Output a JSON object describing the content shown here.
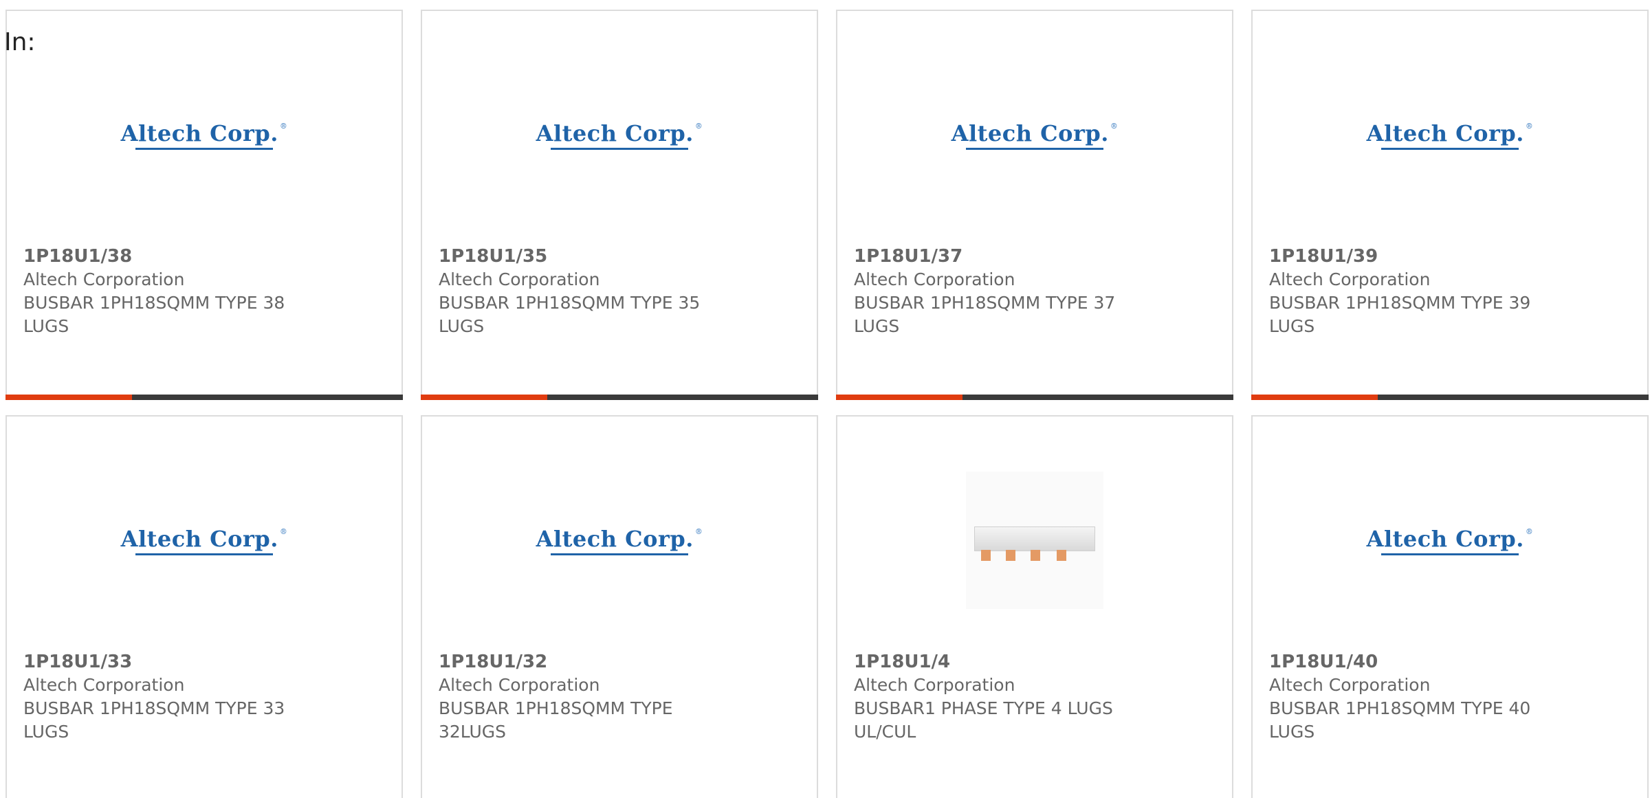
{
  "filter_label": "In:",
  "products": [
    {
      "part_number": "1P18U1/38",
      "manufacturer": "Altech Corporation",
      "description": "BUSBAR 1PH18SQMM TYPE 38 LUGS",
      "image": "altech-logo"
    },
    {
      "part_number": "1P18U1/35",
      "manufacturer": "Altech Corporation",
      "description": "BUSBAR 1PH18SQMM TYPE 35 LUGS",
      "image": "altech-logo"
    },
    {
      "part_number": "1P18U1/37",
      "manufacturer": "Altech Corporation",
      "description": "BUSBAR 1PH18SQMM TYPE 37 LUGS",
      "image": "altech-logo"
    },
    {
      "part_number": "1P18U1/39",
      "manufacturer": "Altech Corporation",
      "description": "BUSBAR 1PH18SQMM TYPE 39 LUGS",
      "image": "altech-logo"
    },
    {
      "part_number": "1P18U1/33",
      "manufacturer": "Altech Corporation",
      "description": "BUSBAR 1PH18SQMM TYPE 33 LUGS",
      "image": "altech-logo"
    },
    {
      "part_number": "1P18U1/32",
      "manufacturer": "Altech Corporation",
      "description": "BUSBAR 1PH18SQMM TYPE 32LUGS",
      "image": "altech-logo"
    },
    {
      "part_number": "1P18U1/4",
      "manufacturer": "Altech Corporation",
      "description": "BUSBAR1 PHASE TYPE 4 LUGS UL/CUL",
      "image": "busbar-photo"
    },
    {
      "part_number": "1P18U1/40",
      "manufacturer": "Altech Corporation",
      "description": "BUSBAR 1PH18SQMM TYPE 40 LUGS",
      "image": "altech-logo"
    }
  ],
  "logo_text": "Altech Corp.",
  "logo_mark": "®",
  "colors": {
    "accent": "#e03c10",
    "bar": "#3a3a3a",
    "logo_blue": "#1f63a8",
    "text": "#666666",
    "border": "#dcdcdc"
  }
}
